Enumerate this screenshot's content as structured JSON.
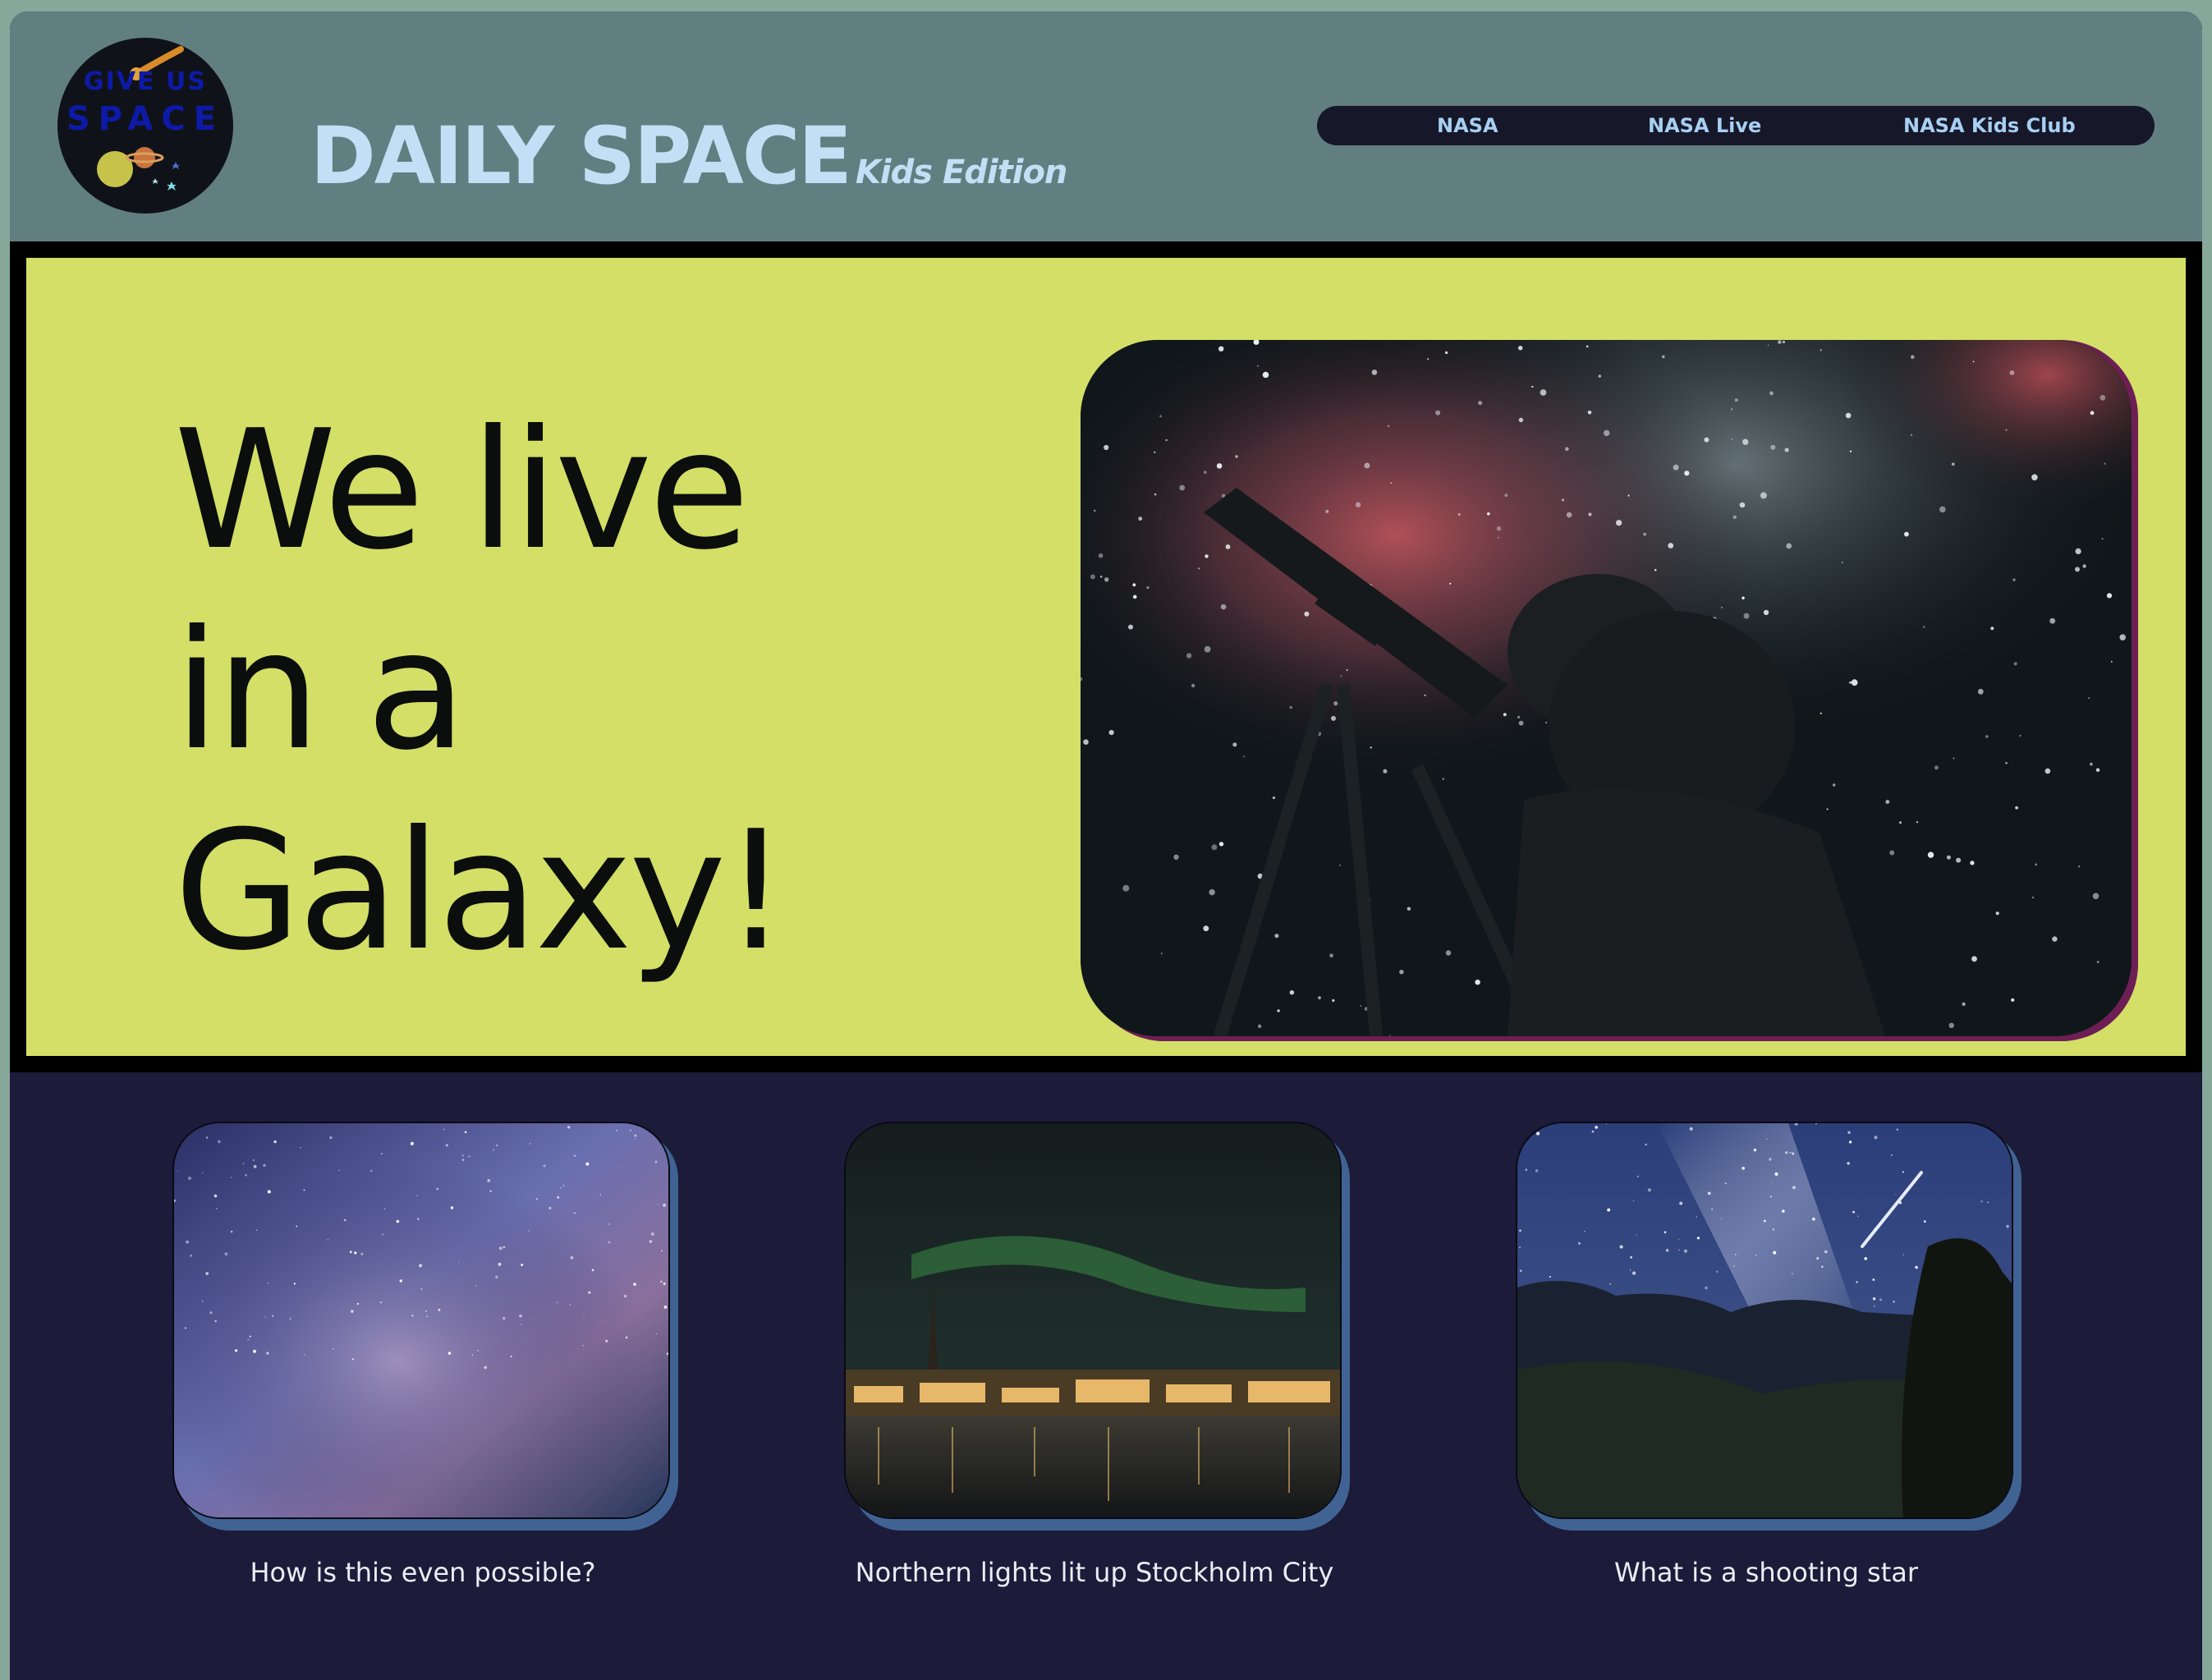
{
  "header": {
    "logo": {
      "line1": "GIVE US",
      "line2": "SPACE"
    },
    "brand_title": "DAILY SPACE",
    "brand_subtitle": "Kids Edition"
  },
  "nav": {
    "items": [
      {
        "label": "NASA"
      },
      {
        "label": "NASA Live"
      },
      {
        "label": "NASA Kids Club"
      }
    ]
  },
  "hero": {
    "lines": [
      "We live",
      "in a",
      "Galaxy!"
    ]
  },
  "cards": [
    {
      "caption": "How is this even possible?"
    },
    {
      "caption": "Northern lights lit up Stockholm City"
    },
    {
      "caption": "What is a shooting star"
    }
  ],
  "colors": {
    "header_bg": "#617f80",
    "hero_bg": "#d3df66",
    "main_bg": "#1c1b3a",
    "nav_bg": "#161729",
    "nav_text": "#a7d0f2",
    "brand_text": "#c4def6",
    "card_shadow": "#406394",
    "hero_img_shadow": "#6d1f55"
  }
}
